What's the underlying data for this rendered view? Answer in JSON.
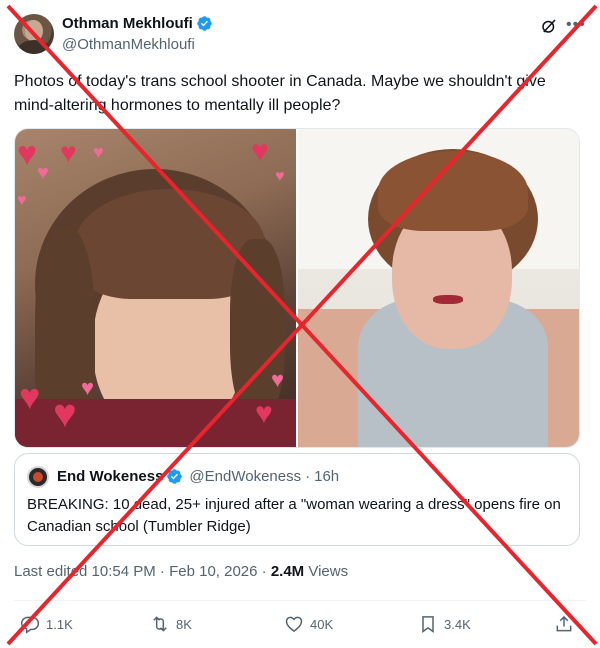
{
  "author": {
    "display_name": "Othman Mekhloufi",
    "handle": "@OthmanMekhloufi",
    "verified": true
  },
  "tweet": {
    "text": "Photos of today's trans school shooter in Canada. Maybe we shouldn't give mind-altering hormones to mentally ill people?"
  },
  "media": {
    "photos": [
      "photo-selfie-with-hearts",
      "photo-selfie-on-pillow"
    ]
  },
  "quoted_tweet": {
    "display_name": "End Wokeness",
    "handle": "@EndWokeness",
    "separator": "·",
    "time": "16h",
    "text": "BREAKING: 10 dead, 25+ injured after a \"woman wearing a dress\" opens fire on Canadian school (Tumbler Ridge)"
  },
  "meta": {
    "edited_label": "Last edited 10:54 PM · Feb 10, 2026 · ",
    "views_count": "2.4M",
    "views_label": " Views"
  },
  "actions": {
    "replies": "1.1K",
    "reposts": "8K",
    "likes": "40K",
    "bookmarks": "3.4K"
  },
  "icons": {
    "reply": "reply-icon",
    "repost": "repost-icon",
    "like": "heart-icon",
    "bookmark": "bookmark-icon",
    "share": "share-icon",
    "grok": "grok-icon",
    "more": "more-icon",
    "verified": "verified-badge-icon"
  },
  "colors": {
    "verified_blue": "#1d9bf0",
    "cross_red": "#e8242c",
    "text_secondary": "#536471"
  }
}
